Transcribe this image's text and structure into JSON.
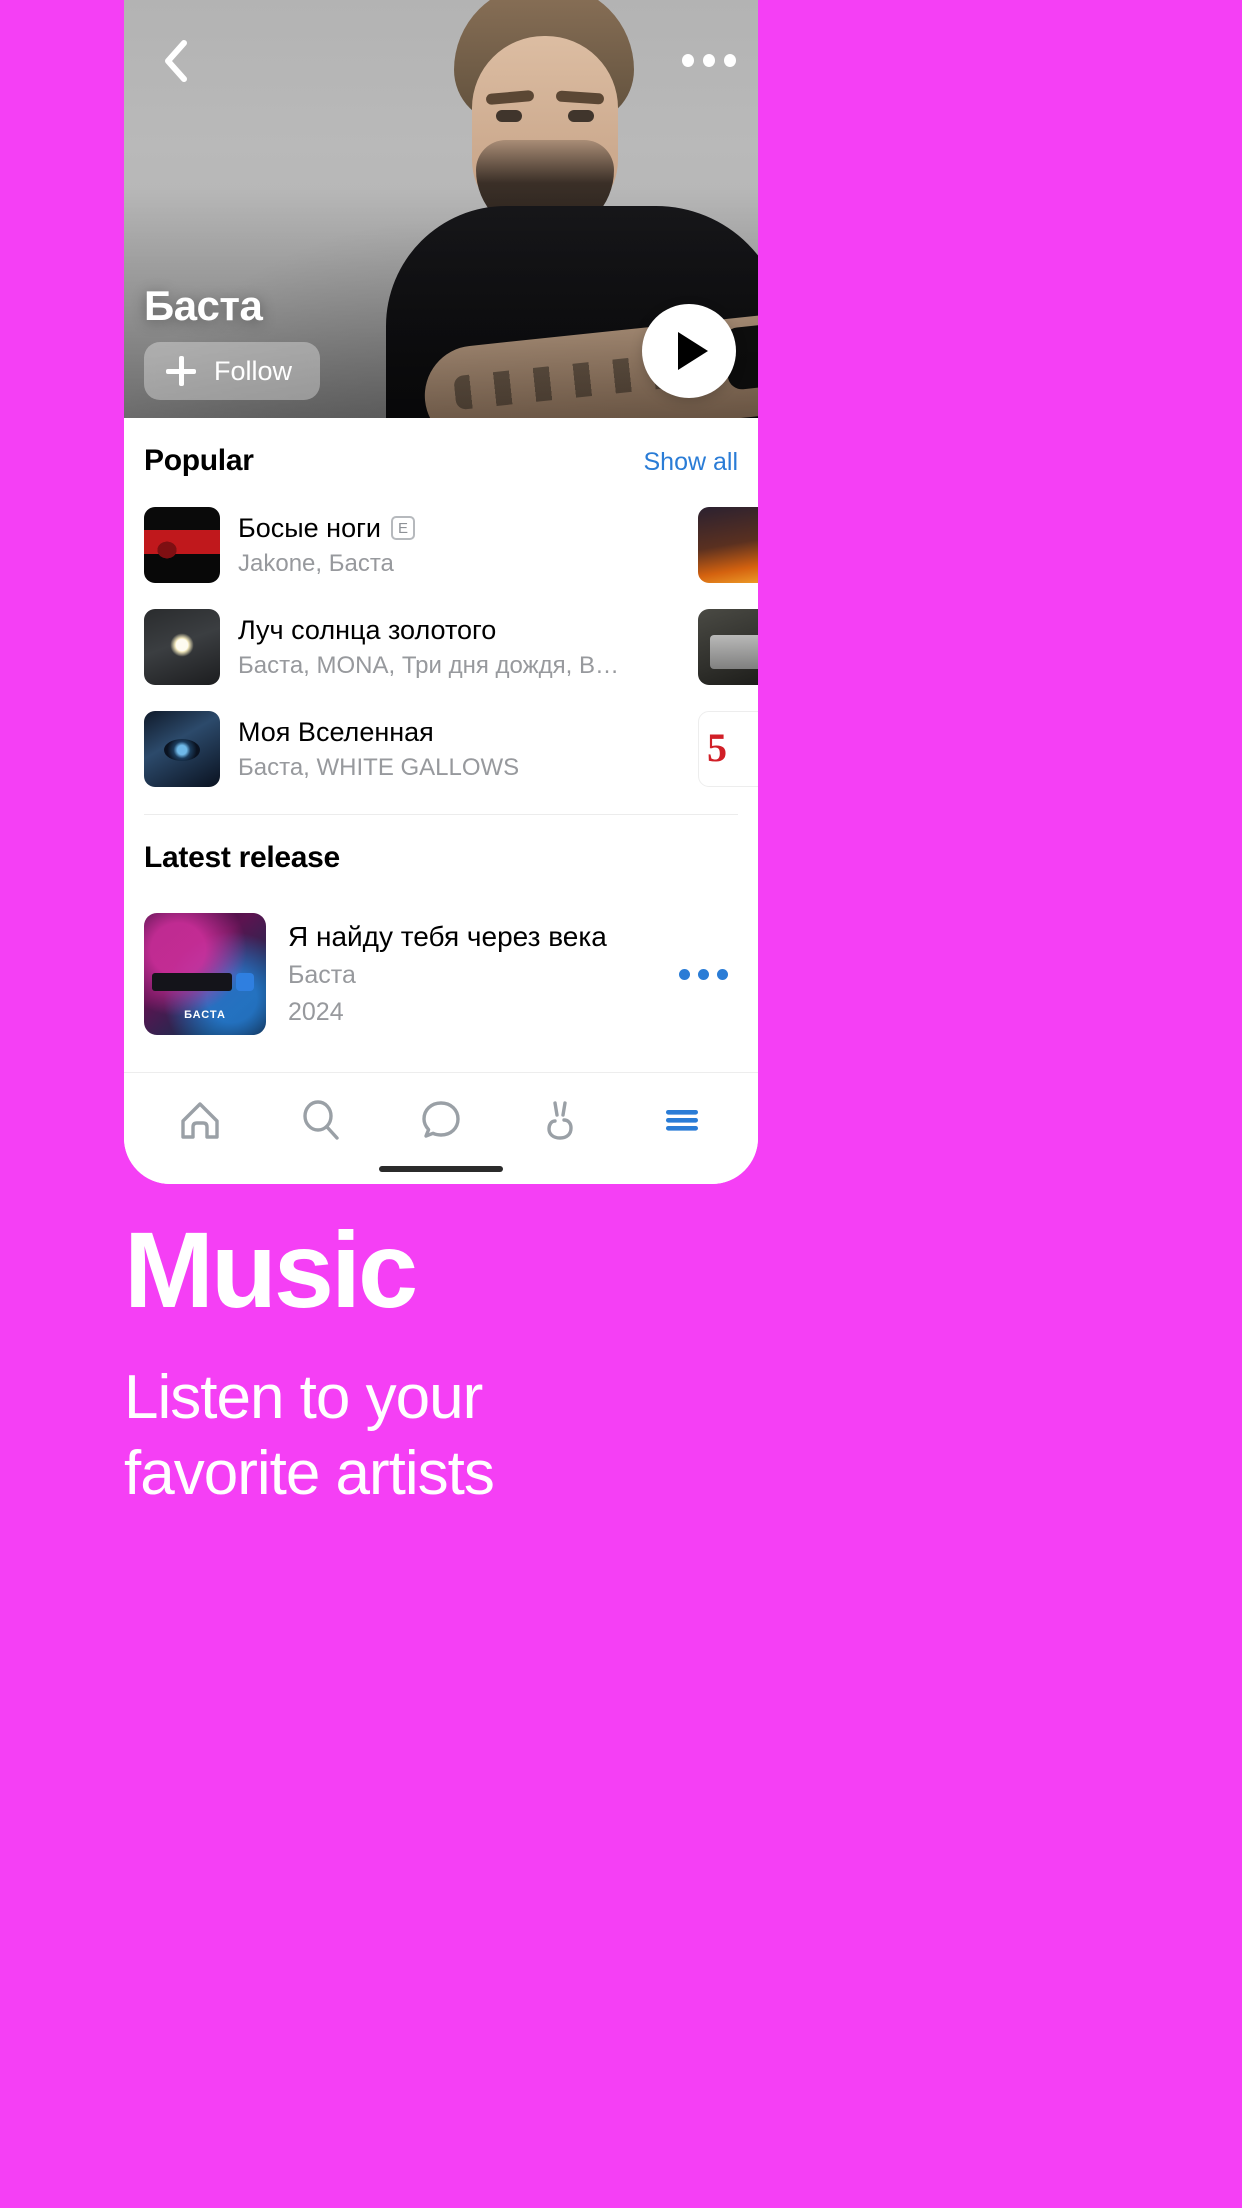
{
  "theme": {
    "background": "#F53FF5",
    "accent_blue": "#2a7cd6",
    "card_background": "#FFFFFF",
    "muted_text": "#97999D"
  },
  "header": {
    "back_icon": "chevron-left-icon",
    "overflow_icon": "more-horizontal-icon",
    "artist_name": "Баста",
    "follow_label": "Follow",
    "follow_plus_icon": "plus-icon",
    "play_icon": "play-icon"
  },
  "popular": {
    "title": "Popular",
    "show_all_label": "Show all",
    "tracks": [
      {
        "title": "Босые ноги",
        "explicit_badge": "E",
        "artists": "Jakone, Баста",
        "menu_icon": "more-horizontal-icon",
        "cover_name": "cover-bosye-nogi"
      },
      {
        "title": "Луч солнца золотого",
        "explicit_badge": "",
        "artists": "Баста, MONA, Три дня дождя, Вла…",
        "menu_icon": "more-horizontal-icon",
        "cover_name": "cover-luch-solnca"
      },
      {
        "title": "Моя Вселенная",
        "explicit_badge": "",
        "artists": "Баста, WHITE GALLOWS",
        "menu_icon": "more-horizontal-icon",
        "cover_name": "cover-moya-vselennaya"
      }
    ],
    "peek_covers": [
      "cover-next-1",
      "cover-next-2",
      "cover-next-3"
    ]
  },
  "latest_release": {
    "title": "Latest release",
    "album": {
      "title": "Я найду тебя через века",
      "artist": "Баста",
      "year": "2024",
      "cover_label": "БАСТА",
      "menu_icon": "more-horizontal-icon"
    }
  },
  "tabbar": {
    "items": [
      {
        "name": "home",
        "icon": "home-icon"
      },
      {
        "name": "search",
        "icon": "search-icon"
      },
      {
        "name": "messages",
        "icon": "chat-bubble-icon"
      },
      {
        "name": "clips",
        "icon": "clips-icon"
      },
      {
        "name": "menu",
        "icon": "hamburger-menu-icon"
      }
    ]
  },
  "promo": {
    "title": "Music",
    "subtitle": "Listen to your\nfavorite artists"
  }
}
